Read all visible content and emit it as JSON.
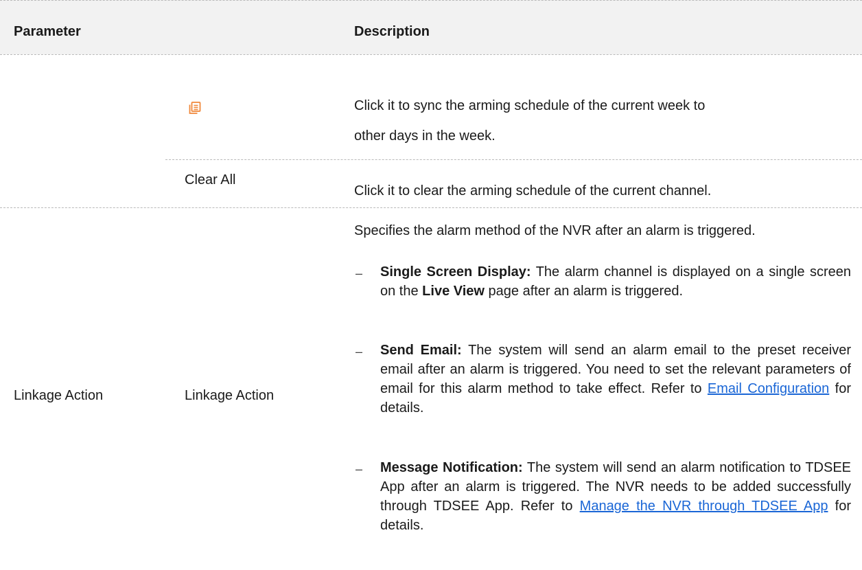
{
  "header": {
    "col_parameter": "Parameter",
    "col_description": "Description"
  },
  "rows": {
    "sync": {
      "icon": "copy-schedule-icon",
      "icon_color": "#f0883a",
      "description": [
        "Click it to sync the arming schedule of the current week to",
        "other days in the week."
      ]
    },
    "clear": {
      "label": "Clear All",
      "description": "Click it to clear the arming schedule of the current channel."
    },
    "linkage": {
      "parameter": "Linkage Action",
      "sub_parameter": "Linkage Action",
      "intro": "Specifies the alarm method of the NVR after an alarm is triggered.",
      "bullet_mark": "–",
      "items": [
        {
          "title": "Single Screen Display:",
          "text1": " The alarm channel is displayed on a single screen on the ",
          "bold": "Live View",
          "text2": " page after an alarm is triggered."
        },
        {
          "title": "Send Email:",
          "text1": " The system will send an alarm email to the preset receiver email after an alarm is triggered. You need to set the relevant parameters of email for this alarm method to take effect. Refer to ",
          "link": "Email Configuration",
          "text2": " for details."
        },
        {
          "title": "Message Notification:",
          "text1": " The system will send an alarm notification to TDSEE App after an alarm is triggered. The NVR needs to be added successfully through TDSEE App. Refer to ",
          "link": "Manage the NVR through TDSEE App",
          "text2": " for details."
        }
      ]
    }
  }
}
